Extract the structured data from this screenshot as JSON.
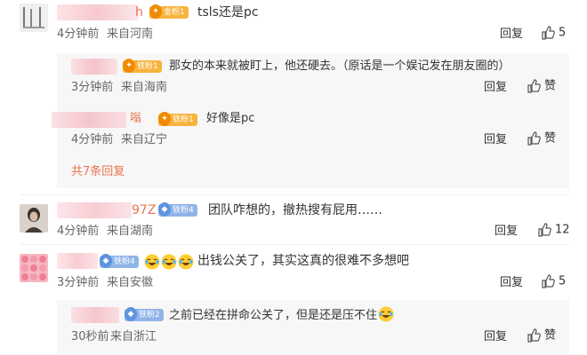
{
  "comments": [
    {
      "user_suffix": "h",
      "badge": "金粉1",
      "text": "tsls还是pc",
      "time": "4分钟前",
      "location": "来自河南",
      "reply_label": "回复",
      "like_count": "5",
      "replies": [
        {
          "badge": "铁粉1",
          "text": "那女的本来就被盯上，他还硬去。（原话是一个娱记发在朋友圈的）",
          "time": "3分钟前",
          "location": "来自海南",
          "reply_label": "回复",
          "like_label": "赞"
        },
        {
          "user_suffix": "嗡",
          "badge": "铁粉1",
          "text": "好像是pc",
          "time": "4分钟前",
          "location": "来自辽宁",
          "reply_label": "回复",
          "like_label": "赞"
        }
      ],
      "more_replies": "共7条回复"
    },
    {
      "user_suffix": "97Z",
      "badge": "铁粉4",
      "text": "团队咋想的，撤热搜有屁用……",
      "time": "4分钟前",
      "location": "来自湖南",
      "reply_label": "回复",
      "like_count": "12"
    },
    {
      "badge": "铁粉4",
      "text": "出钱公关了，其实这真的很难不多想吧",
      "time": "3分钟前",
      "location": "来自安徽",
      "reply_label": "回复",
      "like_count": "5",
      "replies": [
        {
          "badge": "铁粉2",
          "text": "之前已经在拼命公关了，但是还是压不住",
          "time": "30秒前",
          "location": "来自浙江",
          "reply_label": "回复",
          "like_label": "赞"
        }
      ]
    }
  ],
  "colors": {
    "accent": "#eb7350",
    "gold_badge": "#f7b33b",
    "iron_badge": "#8fb4e8",
    "subcomment_bg": "#f7f7f7"
  },
  "icons": {
    "like": "thumb-up-icon",
    "emoji": "laugh-cry-emoji-icon",
    "badge": "fan-badge-icon"
  }
}
